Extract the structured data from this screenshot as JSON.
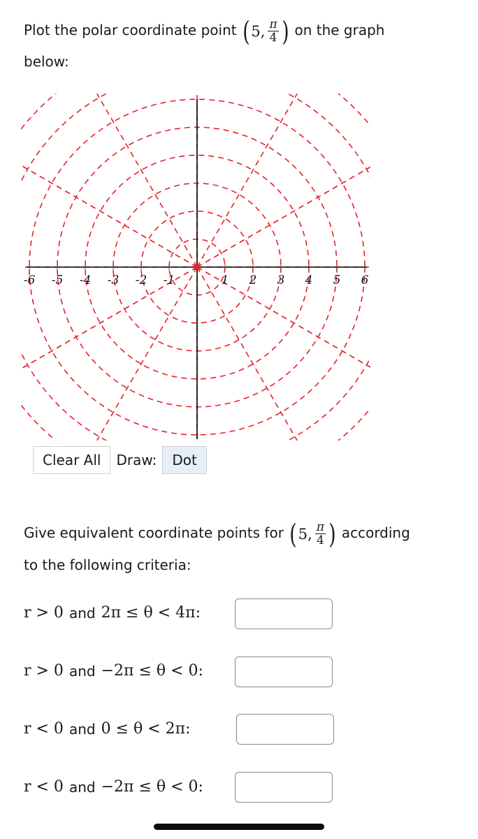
{
  "question1": {
    "prefix": "Plot the polar coordinate point",
    "point": {
      "r": "5,",
      "theta_num": "π",
      "theta_den": "4"
    },
    "suffix": "on the graph",
    "line2": "below:"
  },
  "graph": {
    "x_ticks": [
      "-6",
      "-5",
      "-4",
      "-3",
      "-2",
      "-1",
      "1",
      "2",
      "3",
      "4",
      "5",
      "6"
    ],
    "x_range": [
      -6.3,
      6.2
    ],
    "y_range": [
      -6.2,
      6.2
    ],
    "circle_radii": [
      1,
      2,
      3,
      4,
      5,
      6,
      7,
      8
    ],
    "radial_step_degrees": 30,
    "grid_color": "#e8202a",
    "axis_color": "#000000",
    "origin_marker_color": "#e8202a"
  },
  "toolbar": {
    "clear_label": "Clear All",
    "draw_label": "Draw:",
    "dot_label": "Dot"
  },
  "question2": {
    "prefix": "Give equivalent coordinate points for",
    "point": {
      "r": "5,",
      "theta_num": "π",
      "theta_den": "4"
    },
    "suffix": "according",
    "line2": "to the following criteria:"
  },
  "criteria": [
    {
      "r_cond": "r > 0",
      "and": "and",
      "theta_cond": "2π ≤ θ < 4π:",
      "answer": ""
    },
    {
      "r_cond": "r > 0",
      "and": "and",
      "theta_cond": "−2π ≤ θ < 0:",
      "answer": ""
    },
    {
      "r_cond": "r < 0",
      "and": "and",
      "theta_cond": "0 ≤ θ < 2π:",
      "answer": ""
    },
    {
      "r_cond": "r < 0",
      "and": "and",
      "theta_cond": "−2π ≤ θ < 0:",
      "answer": ""
    }
  ]
}
